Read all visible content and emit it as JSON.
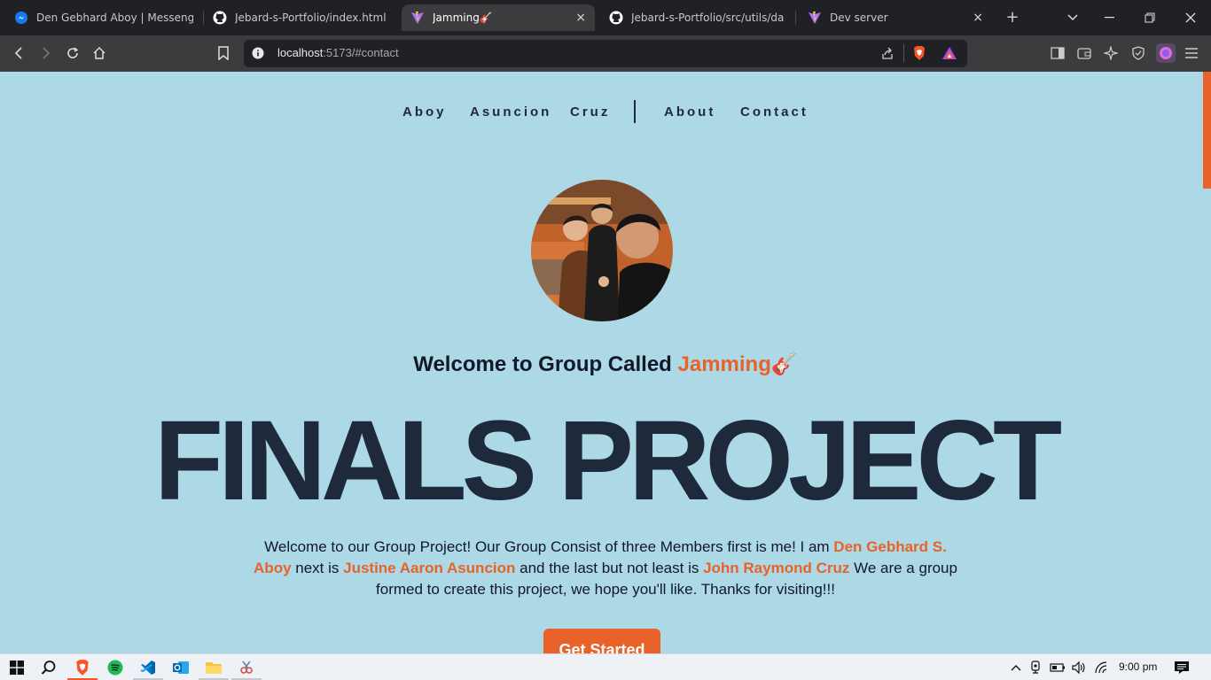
{
  "browser": {
    "tabs": [
      {
        "label": "Den Gebhard Aboy | Messenger",
        "icon": "messenger-icon",
        "active": false
      },
      {
        "label": "Jebard-s-Portfolio/index.html at",
        "icon": "github-icon",
        "active": false
      },
      {
        "label": "Jamming🎸",
        "icon": "vite-icon",
        "active": true
      },
      {
        "label": "Jebard-s-Portfolio/src/utils/dark-",
        "icon": "github-icon",
        "active": false
      },
      {
        "label": "Dev server",
        "icon": "vite-icon",
        "active": false
      }
    ],
    "close_glyph": "×",
    "new_tab_glyph": "+",
    "address": {
      "host": "localhost",
      "rest": ":5173/#contact"
    }
  },
  "page": {
    "nav": {
      "links": [
        "Aboy",
        "Asuncion",
        "Cruz",
        "About",
        "Contact"
      ]
    },
    "welcome": {
      "prefix": "Welcome to Group Called ",
      "accent": "Jamming",
      "emoji": "🎸"
    },
    "hero_title": "FINALS PROJECT",
    "description": {
      "part1": "Welcome to our Group Project! Our Group Consist of three Members first is me! I am ",
      "name1": "Den Gebhard S. Aboy",
      "part2": " next is ",
      "name2": "Justine Aaron Asuncion",
      "part3": " and the last but not least is ",
      "name3": "John Raymond Cruz",
      "part4": " We are a group formed to create this project, we hope you'll like. Thanks for visiting!!!"
    },
    "cta_label": "Get Started"
  },
  "taskbar": {
    "time": "9:00 pm"
  },
  "colors": {
    "page_bg": "#add8e6",
    "accent": "#e8622a",
    "text_dark": "#1e293b"
  }
}
